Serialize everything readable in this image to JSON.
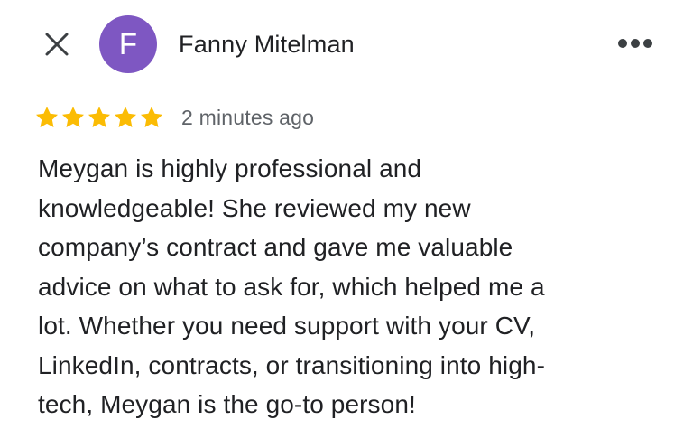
{
  "header": {
    "close_icon": "close-icon",
    "avatar_letter": "F",
    "avatar_color": "#7e57c2",
    "reviewer_name": "Fanny Mitelman",
    "more_icon": "more-horiz-icon"
  },
  "review": {
    "rating": 5,
    "max_rating": 5,
    "star_color": "#fbbc04",
    "timestamp": "2 minutes ago",
    "lines": [
      "Meygan is highly professional and",
      "knowledgeable! She reviewed my new",
      "company’s contract and gave me valuable",
      "advice on what to ask for, which helped me a",
      "lot. Whether you need support with your CV,",
      "LinkedIn, contracts, or transitioning into high-",
      "tech, Meygan is the go-to person!"
    ]
  }
}
